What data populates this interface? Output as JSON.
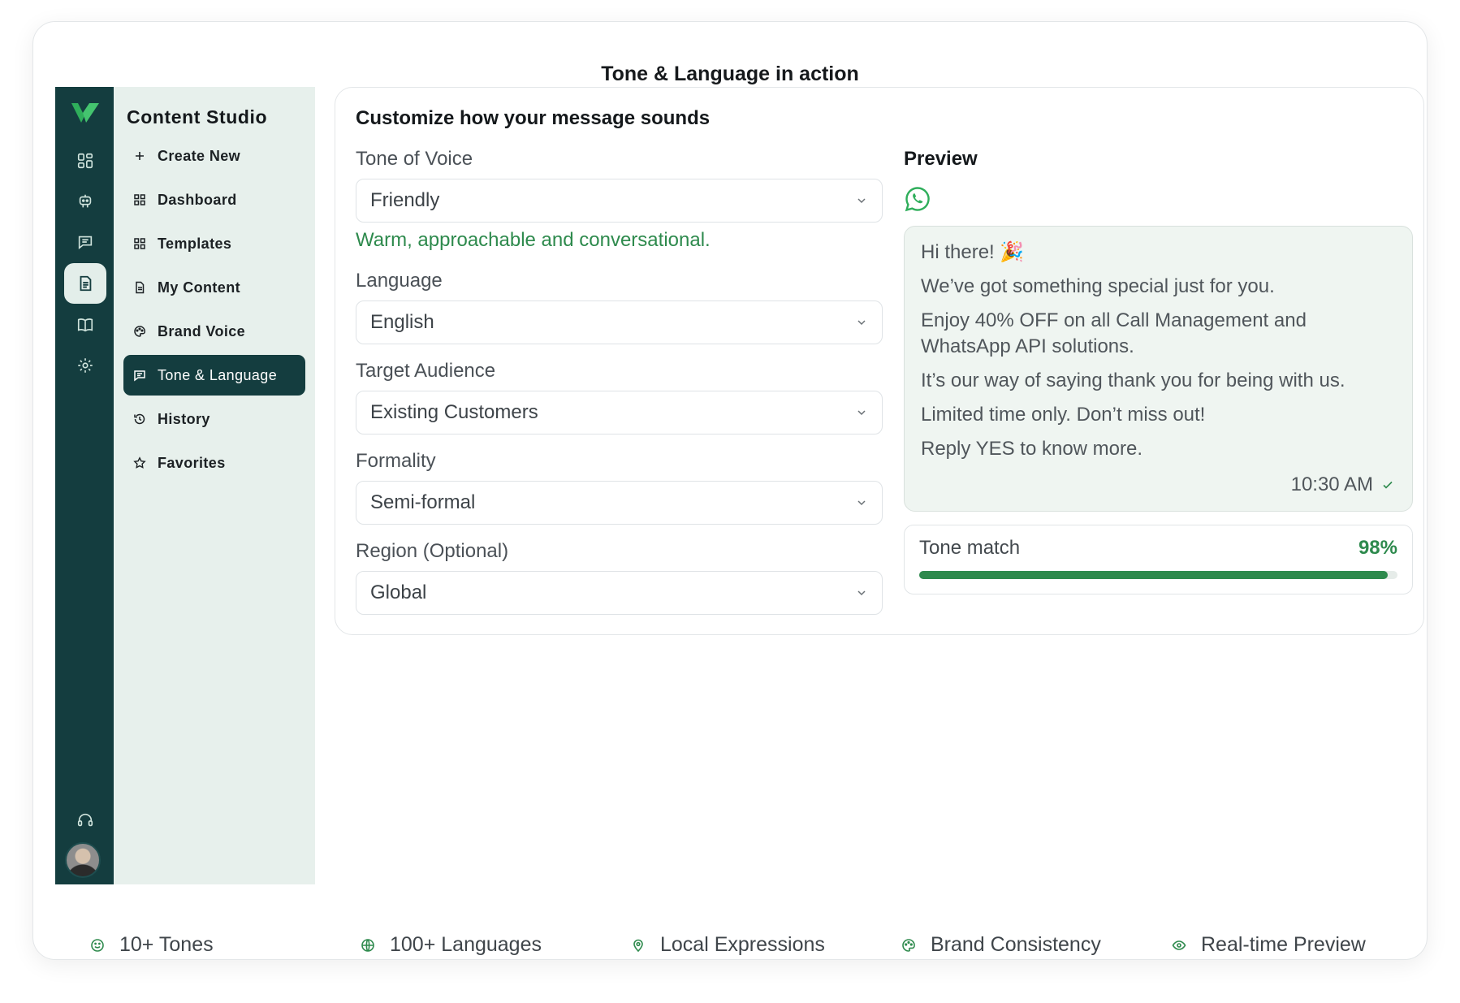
{
  "frame": {
    "title": "Tone & Language in action"
  },
  "rail": {
    "icons": [
      "dashboard-icon",
      "robot-icon",
      "chat-icon",
      "document-icon",
      "book-icon",
      "gear-icon",
      "headset-icon"
    ],
    "active": "document-icon"
  },
  "sidebar": {
    "brand": "Content Studio",
    "items": [
      {
        "label": "Create New",
        "icon": "plus-icon"
      },
      {
        "label": "Dashboard",
        "icon": "grid-icon"
      },
      {
        "label": "Templates",
        "icon": "grid-icon"
      },
      {
        "label": "My Content",
        "icon": "file-icon"
      },
      {
        "label": "Brand Voice",
        "icon": "palette-icon"
      },
      {
        "label": "Tone & Language",
        "icon": "message-icon",
        "active": true
      },
      {
        "label": "History",
        "icon": "history-icon"
      },
      {
        "label": "Favorites",
        "icon": "star-icon"
      }
    ]
  },
  "main": {
    "title": "Customize how your message sounds",
    "tone": {
      "label": "Tone of Voice",
      "value": "Friendly",
      "hint": "Warm, approachable and conversational."
    },
    "language": {
      "label": "Language",
      "value": "English"
    },
    "audience": {
      "label": "Target Audience",
      "value": "Existing Customers"
    },
    "formality": {
      "label": "Formality",
      "value": "Semi-formal"
    },
    "region": {
      "label": "Region (Optional)",
      "value": "Global"
    }
  },
  "preview": {
    "title": "Preview",
    "icon": "whatsapp-icon",
    "message": {
      "line1": "Hi there! 🎉",
      "line2": "We’ve got something special just for you.",
      "line3": "Enjoy 40% OFF on all Call Management and WhatsApp API solutions.",
      "line4": "It’s our way of saying thank you for being with us.",
      "line5": "Limited time only. Don’t miss out!",
      "line6": "Reply YES to know more."
    },
    "time": "10:30 AM",
    "tone_match": {
      "label": "Tone match",
      "value_text": "98%",
      "value": 0.98
    }
  },
  "features": [
    {
      "label": "10+ Tones",
      "icon": "smile-icon"
    },
    {
      "label": "100+ Languages",
      "icon": "globe-icon"
    },
    {
      "label": "Local Expressions",
      "icon": "map-pin-icon"
    },
    {
      "label": "Brand Consistency",
      "icon": "palette-icon"
    },
    {
      "label": "Real-time Preview",
      "icon": "eye-icon"
    }
  ],
  "colors": {
    "rail": "#143d3f",
    "sidebar": "#e7f0ec",
    "accent": "#2e8a4d",
    "bubble": "#eff5f1"
  }
}
